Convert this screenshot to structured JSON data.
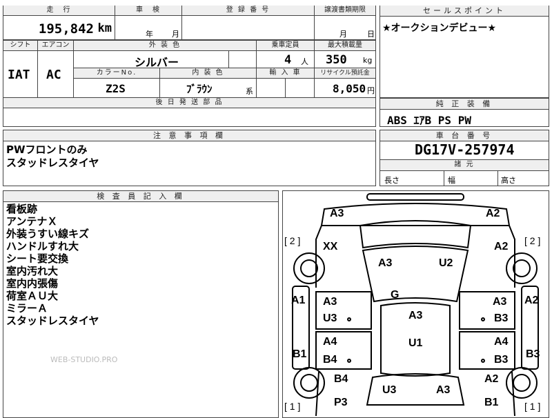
{
  "top_row": {
    "mileage_label": "走　行",
    "inspection_label": "車　検",
    "reg_label": "登 録 番 号",
    "transfer_label": "譲渡書類期限",
    "mileage_value": "195,842",
    "mileage_unit": "km",
    "inspection_year": "年",
    "inspection_month": "月",
    "transfer_month": "月",
    "transfer_day": "日"
  },
  "spec_row": {
    "shift_label": "シフト",
    "ac_label": "エアコン",
    "color_label": "外 装 色",
    "seats_label": "乗車定員",
    "load_label": "最大積載量",
    "shift_value": "IAT",
    "ac_value": "AC",
    "color_value": "シルバー",
    "seats_value": "4",
    "seats_unit": "人",
    "load_value": "350",
    "load_unit": "kg",
    "colorno_label": "カラーNo.",
    "interior_label": "内 装 色",
    "import_label": "輸 入 車",
    "recycle_label": "リサイクル預託金",
    "colorno_value": "Z2S",
    "interior_value": "ﾌﾞﾗｳﾝ",
    "interior_unit": "系",
    "recycle_value": "8,050",
    "recycle_unit": "円",
    "later_parts_label": "後 日 発 送 部 品"
  },
  "sales_point": {
    "label": "セールスポイント",
    "text": "★オークションデビュー★"
  },
  "equipment": {
    "label": "純 正 装 備",
    "text": "ABS ｴｱB PS PW"
  },
  "caution": {
    "label": "注 意 事 項 欄",
    "lines": [
      "PWフロントのみ",
      "スタッドレスタイヤ"
    ]
  },
  "chassis": {
    "label": "車 台 番 号",
    "value": "DG17V-257974",
    "dims_label": "諸 元",
    "length_label": "長さ",
    "width_label": "幅",
    "height_label": "高さ"
  },
  "inspector": {
    "label": "検 査 員 記 入 欄",
    "lines": [
      "看板跡",
      "アンテナＸ",
      "外装うすい線キズ",
      "ハンドルすれ大",
      "シート要交換",
      "室内汚れ大",
      "室内内張傷",
      "荷室ＡＵ大",
      "ミラーＡ",
      "スタッドレスタイヤ"
    ],
    "watermark": "WEB-STUDIO.PRO"
  },
  "diagram": {
    "marks": {
      "front_left": "A3",
      "front_right": "A2",
      "left_count": "[ 2 ]",
      "right_count": "[ 2 ]",
      "xx": "XX",
      "hood_left": "A3",
      "hood_right": "U2",
      "right_fender": "A2",
      "roof_g": "G",
      "left_a1": "A1",
      "right_a2": "A2",
      "ld_a3": "A3",
      "ld_u3": "U3",
      "rd_a3": "A3",
      "rd_b3": "B3",
      "roof_a3": "A3",
      "roof_u1": "U1",
      "ld2_a4": "A4",
      "ld2_b4": "B4",
      "rd2_a4": "A4",
      "rd2_b3": "B3",
      "left_b1": "B1",
      "right_b3": "B3",
      "lr_b4": "B4",
      "rr_a2": "A2",
      "rear_u3": "U3",
      "rear_a3": "A3",
      "rear_p3": "P3",
      "rear_b1": "B1",
      "bottom_left_count": "[ 1 ]",
      "bottom_right_count": "[ 1 ]"
    }
  }
}
